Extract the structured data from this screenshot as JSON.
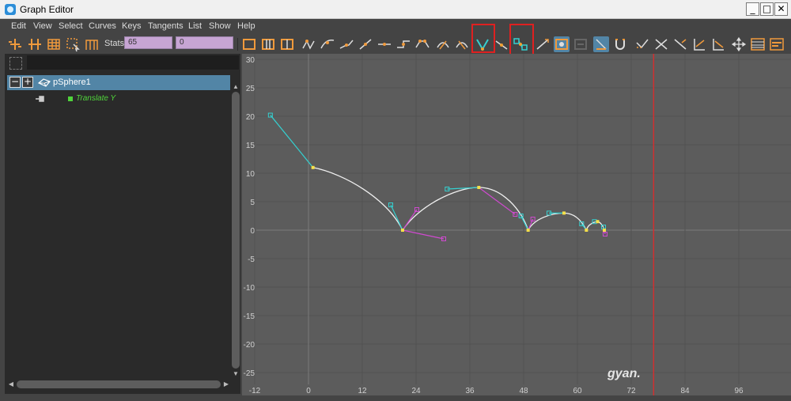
{
  "window": {
    "title": "Graph Editor",
    "minimize": "_",
    "maximize": "□",
    "close": "✕"
  },
  "menu": [
    "Edit",
    "View",
    "Select",
    "Curves",
    "Keys",
    "Tangents",
    "List",
    "Show",
    "Help"
  ],
  "toolbar": {
    "stats_label": "Stats",
    "stats_frame": "65",
    "stats_value": "0"
  },
  "outliner": {
    "object_name": "pSphere1",
    "collapse_symbol": "−",
    "expand_symbol": "+",
    "attribute": "Translate Y",
    "attribute_color": "#4fd33b"
  },
  "graph": {
    "y_ticks": [
      "30",
      "25",
      "20",
      "15",
      "10",
      "5",
      "0",
      "-5",
      "-10",
      "-15",
      "-20",
      "-25"
    ],
    "x_ticks": [
      "-12",
      "0",
      "12",
      "24",
      "36",
      "48",
      "60",
      "72",
      "84",
      "96"
    ],
    "current_frame": 77,
    "curve_keys": [
      {
        "frame": 1,
        "value": 11
      },
      {
        "frame": 21,
        "value": 0
      },
      {
        "frame": 38,
        "value": 7.5
      },
      {
        "frame": 49,
        "value": 0
      },
      {
        "frame": 57,
        "value": 3
      },
      {
        "frame": 62,
        "value": 0
      },
      {
        "frame": 64.5,
        "value": 1.5
      },
      {
        "frame": 66,
        "value": 0
      }
    ],
    "curve_color": "#f0f0f0",
    "tangent_color": "#35d0d0",
    "out_tangent_color": "#d04ad0",
    "time_cursor_color": "#d03030",
    "watermark": "gyan."
  }
}
